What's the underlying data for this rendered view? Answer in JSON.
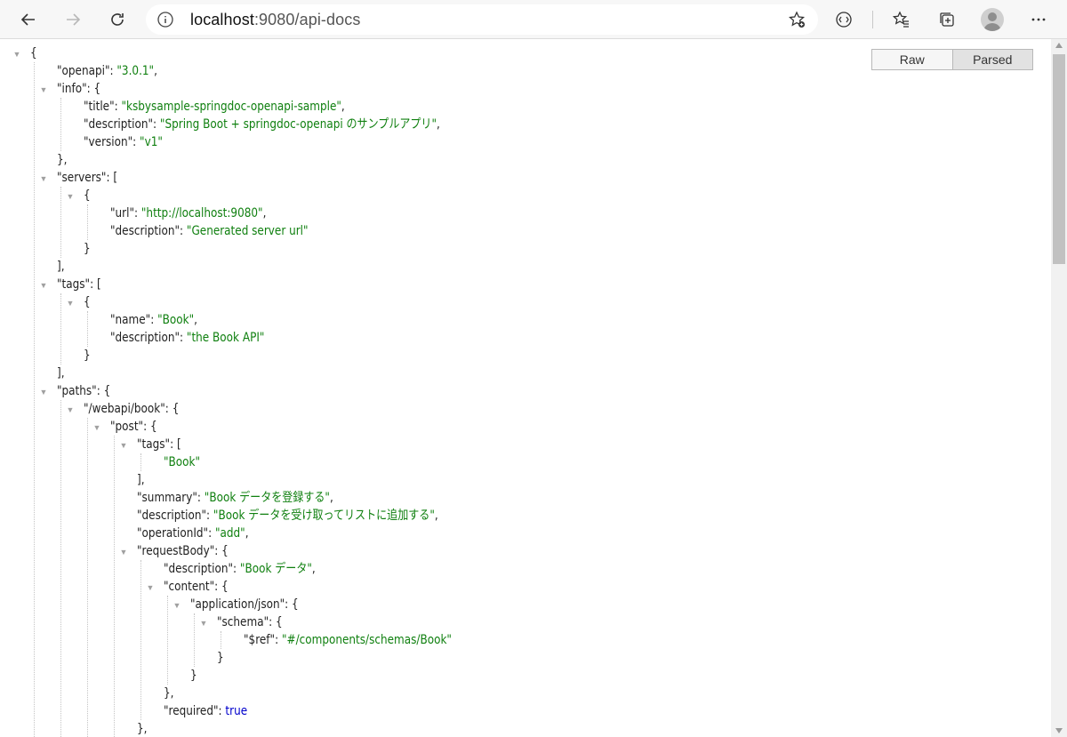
{
  "browser": {
    "address_host": "localhost",
    "address_rest": ":9080/api-docs",
    "icons": [
      "back-arrow-icon",
      "forward-arrow-icon",
      "refresh-icon",
      "info-icon",
      "add-favorite-icon",
      "reading-view-icon",
      "favorites-icon",
      "collections-icon",
      "profile-avatar-icon",
      "more-menu-icon"
    ]
  },
  "view_toggle": {
    "raw_label": "Raw",
    "parsed_label": "Parsed"
  },
  "json_lines": [
    {
      "i": 0,
      "t": 1,
      "parts": [
        [
          "punc",
          "{"
        ]
      ]
    },
    {
      "i": 1,
      "t": 0,
      "parts": [
        [
          "key",
          "\"openapi\""
        ],
        [
          "punc",
          ": "
        ],
        [
          "str",
          "\"3.0.1\""
        ],
        [
          "punc",
          ","
        ]
      ]
    },
    {
      "i": 1,
      "t": 1,
      "parts": [
        [
          "key",
          "\"info\""
        ],
        [
          "punc",
          ": {"
        ]
      ]
    },
    {
      "i": 2,
      "t": 0,
      "parts": [
        [
          "key",
          "\"title\""
        ],
        [
          "punc",
          ": "
        ],
        [
          "str",
          "\"ksbysample-springdoc-openapi-sample\""
        ],
        [
          "punc",
          ","
        ]
      ]
    },
    {
      "i": 2,
      "t": 0,
      "parts": [
        [
          "key",
          "\"description\""
        ],
        [
          "punc",
          ": "
        ],
        [
          "str",
          "\"Spring Boot + springdoc-openapi のサンプルアプリ\""
        ],
        [
          "punc",
          ","
        ]
      ]
    },
    {
      "i": 2,
      "t": 0,
      "parts": [
        [
          "key",
          "\"version\""
        ],
        [
          "punc",
          ": "
        ],
        [
          "str",
          "\"v1\""
        ]
      ]
    },
    {
      "i": 1,
      "t": 0,
      "parts": [
        [
          "punc",
          "},"
        ]
      ]
    },
    {
      "i": 1,
      "t": 1,
      "parts": [
        [
          "key",
          "\"servers\""
        ],
        [
          "punc",
          ": ["
        ]
      ]
    },
    {
      "i": 2,
      "t": 1,
      "parts": [
        [
          "punc",
          "{"
        ]
      ]
    },
    {
      "i": 3,
      "t": 0,
      "parts": [
        [
          "key",
          "\"url\""
        ],
        [
          "punc",
          ": "
        ],
        [
          "str",
          "\"http://localhost:9080\""
        ],
        [
          "punc",
          ","
        ]
      ]
    },
    {
      "i": 3,
      "t": 0,
      "parts": [
        [
          "key",
          "\"description\""
        ],
        [
          "punc",
          ": "
        ],
        [
          "str",
          "\"Generated server url\""
        ]
      ]
    },
    {
      "i": 2,
      "t": 0,
      "parts": [
        [
          "punc",
          "}"
        ]
      ]
    },
    {
      "i": 1,
      "t": 0,
      "parts": [
        [
          "punc",
          "],"
        ]
      ]
    },
    {
      "i": 1,
      "t": 1,
      "parts": [
        [
          "key",
          "\"tags\""
        ],
        [
          "punc",
          ": ["
        ]
      ]
    },
    {
      "i": 2,
      "t": 1,
      "parts": [
        [
          "punc",
          "{"
        ]
      ]
    },
    {
      "i": 3,
      "t": 0,
      "parts": [
        [
          "key",
          "\"name\""
        ],
        [
          "punc",
          ": "
        ],
        [
          "str",
          "\"Book\""
        ],
        [
          "punc",
          ","
        ]
      ]
    },
    {
      "i": 3,
      "t": 0,
      "parts": [
        [
          "key",
          "\"description\""
        ],
        [
          "punc",
          ": "
        ],
        [
          "str",
          "\"the Book API\""
        ]
      ]
    },
    {
      "i": 2,
      "t": 0,
      "parts": [
        [
          "punc",
          "}"
        ]
      ]
    },
    {
      "i": 1,
      "t": 0,
      "parts": [
        [
          "punc",
          "],"
        ]
      ]
    },
    {
      "i": 1,
      "t": 1,
      "parts": [
        [
          "key",
          "\"paths\""
        ],
        [
          "punc",
          ": {"
        ]
      ]
    },
    {
      "i": 2,
      "t": 1,
      "parts": [
        [
          "key",
          "\"/webapi/book\""
        ],
        [
          "punc",
          ": {"
        ]
      ]
    },
    {
      "i": 3,
      "t": 1,
      "parts": [
        [
          "key",
          "\"post\""
        ],
        [
          "punc",
          ": {"
        ]
      ]
    },
    {
      "i": 4,
      "t": 1,
      "parts": [
        [
          "key",
          "\"tags\""
        ],
        [
          "punc",
          ": ["
        ]
      ]
    },
    {
      "i": 5,
      "t": 0,
      "parts": [
        [
          "str",
          "\"Book\""
        ]
      ]
    },
    {
      "i": 4,
      "t": 0,
      "parts": [
        [
          "punc",
          "],"
        ]
      ]
    },
    {
      "i": 4,
      "t": 0,
      "parts": [
        [
          "key",
          "\"summary\""
        ],
        [
          "punc",
          ": "
        ],
        [
          "str",
          "\"Book データを登録する\""
        ],
        [
          "punc",
          ","
        ]
      ]
    },
    {
      "i": 4,
      "t": 0,
      "parts": [
        [
          "key",
          "\"description\""
        ],
        [
          "punc",
          ": "
        ],
        [
          "str",
          "\"Book データを受け取ってリストに追加する\""
        ],
        [
          "punc",
          ","
        ]
      ]
    },
    {
      "i": 4,
      "t": 0,
      "parts": [
        [
          "key",
          "\"operationId\""
        ],
        [
          "punc",
          ": "
        ],
        [
          "str",
          "\"add\""
        ],
        [
          "punc",
          ","
        ]
      ]
    },
    {
      "i": 4,
      "t": 1,
      "parts": [
        [
          "key",
          "\"requestBody\""
        ],
        [
          "punc",
          ": {"
        ]
      ]
    },
    {
      "i": 5,
      "t": 0,
      "parts": [
        [
          "key",
          "\"description\""
        ],
        [
          "punc",
          ": "
        ],
        [
          "str",
          "\"Book データ\""
        ],
        [
          "punc",
          ","
        ]
      ]
    },
    {
      "i": 5,
      "t": 1,
      "parts": [
        [
          "key",
          "\"content\""
        ],
        [
          "punc",
          ": {"
        ]
      ]
    },
    {
      "i": 6,
      "t": 1,
      "parts": [
        [
          "key",
          "\"application/json\""
        ],
        [
          "punc",
          ": {"
        ]
      ]
    },
    {
      "i": 7,
      "t": 1,
      "parts": [
        [
          "key",
          "\"schema\""
        ],
        [
          "punc",
          ": {"
        ]
      ]
    },
    {
      "i": 8,
      "t": 0,
      "parts": [
        [
          "key",
          "\"$ref\""
        ],
        [
          "punc",
          ": "
        ],
        [
          "str",
          "\"#/components/schemas/Book\""
        ]
      ]
    },
    {
      "i": 7,
      "t": 0,
      "parts": [
        [
          "punc",
          "}"
        ]
      ]
    },
    {
      "i": 6,
      "t": 0,
      "parts": [
        [
          "punc",
          "}"
        ]
      ]
    },
    {
      "i": 5,
      "t": 0,
      "parts": [
        [
          "punc",
          "},"
        ]
      ]
    },
    {
      "i": 5,
      "t": 0,
      "parts": [
        [
          "key",
          "\"required\""
        ],
        [
          "punc",
          ": "
        ],
        [
          "bool",
          "true"
        ]
      ]
    },
    {
      "i": 4,
      "t": 0,
      "parts": [
        [
          "punc",
          "},"
        ]
      ]
    }
  ]
}
